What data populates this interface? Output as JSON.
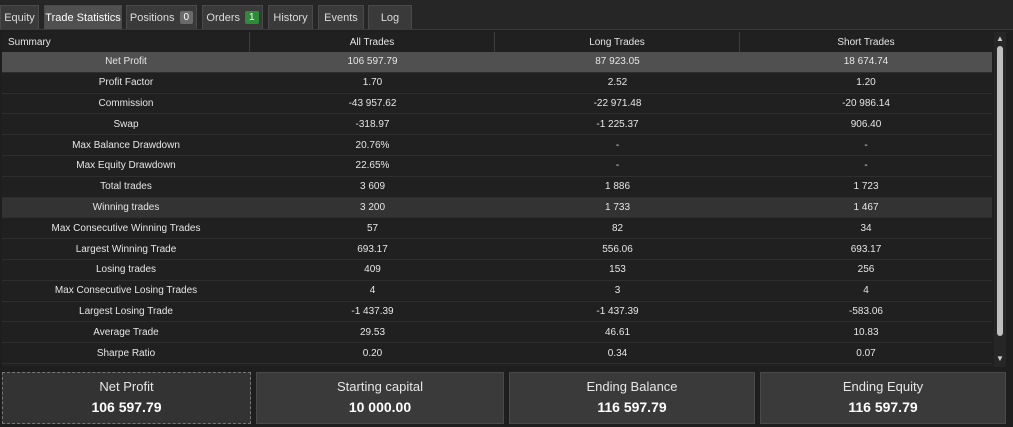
{
  "tabs": [
    {
      "label": "Equity"
    },
    {
      "label": "Trade Statistics",
      "active": true
    },
    {
      "label": "Positions",
      "badge": "0",
      "badge_color": "#6a6a6a"
    },
    {
      "label": "Orders",
      "badge": "1",
      "badge_color": "#2e8b3a"
    },
    {
      "label": "History"
    },
    {
      "label": "Events"
    },
    {
      "label": "Log"
    }
  ],
  "table": {
    "headers": [
      "Summary",
      "All Trades",
      "Long Trades",
      "Short Trades"
    ],
    "rows": [
      [
        "Net Profit",
        "106 597.79",
        "87 923.05",
        "18 674.74"
      ],
      [
        "Profit Factor",
        "1.70",
        "2.52",
        "1.20"
      ],
      [
        "Commission",
        "-43 957.62",
        "-22 971.48",
        "-20 986.14"
      ],
      [
        "Swap",
        "-318.97",
        "-1 225.37",
        "906.40"
      ],
      [
        "Max Balance Drawdown",
        "20.76%",
        "-",
        "-"
      ],
      [
        "Max Equity Drawdown",
        "22.65%",
        "-",
        "-"
      ],
      [
        "Total trades",
        "3 609",
        "1 886",
        "1 723"
      ],
      [
        "Winning trades",
        "3 200",
        "1 733",
        "1 467"
      ],
      [
        "Max Consecutive Winning Trades",
        "57",
        "82",
        "34"
      ],
      [
        "Largest Winning Trade",
        "693.17",
        "556.06",
        "693.17"
      ],
      [
        "Losing trades",
        "409",
        "153",
        "256"
      ],
      [
        "Max Consecutive Losing Trades",
        "4",
        "3",
        "4"
      ],
      [
        "Largest Losing Trade",
        "-1 437.39",
        "-1 437.39",
        "-583.06"
      ],
      [
        "Average Trade",
        "29.53",
        "46.61",
        "10.83"
      ],
      [
        "Sharpe Ratio",
        "0.20",
        "0.34",
        "0.07"
      ]
    ]
  },
  "summary_cards": [
    {
      "label": "Net Profit",
      "value": "106 597.79"
    },
    {
      "label": "Starting capital",
      "value": "10 000.00"
    },
    {
      "label": "Ending Balance",
      "value": "116 597.79"
    },
    {
      "label": "Ending Equity",
      "value": "116 597.79"
    }
  ],
  "scrollbar": {
    "up_icon": "▲",
    "down_icon": "▼"
  }
}
